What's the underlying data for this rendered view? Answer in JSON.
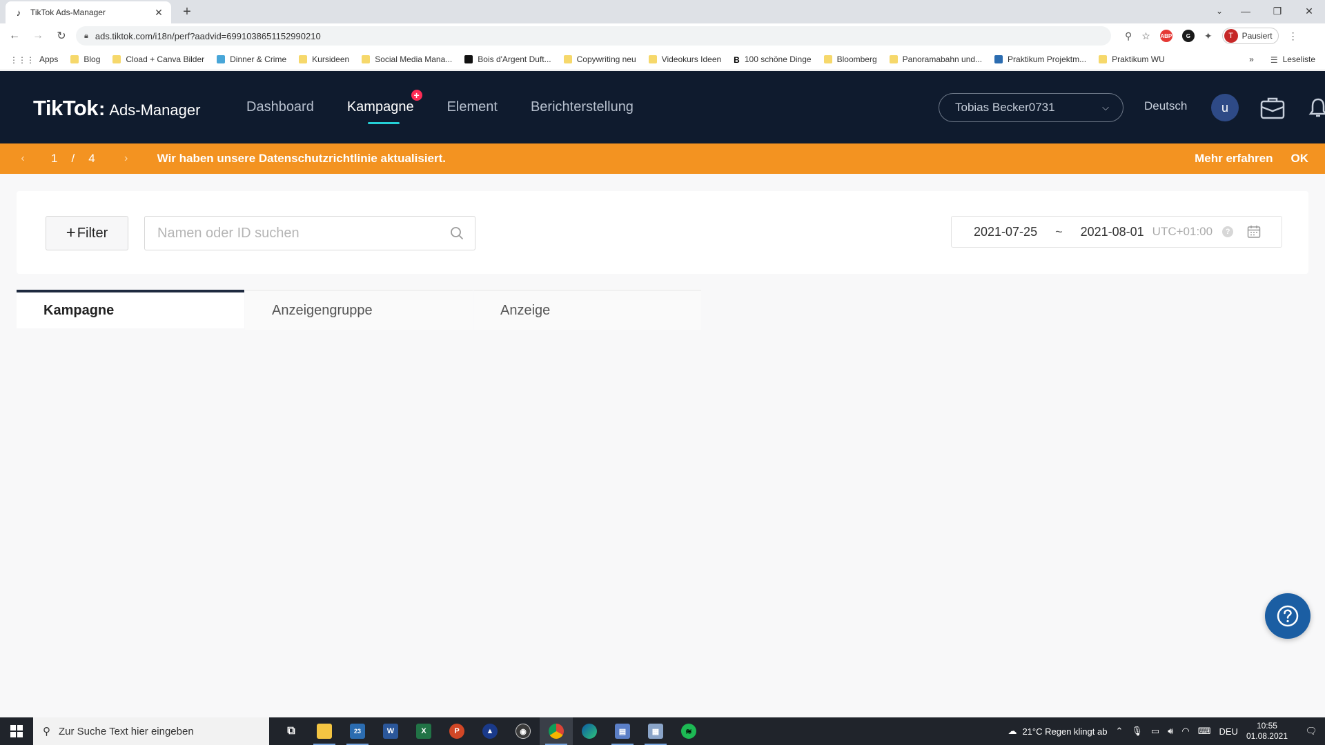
{
  "browser": {
    "tab_title": "TikTok Ads-Manager",
    "url": "ads.tiktok.com/i18n/perf?aadvid=6991038651152990210",
    "profile_status": "Pausiert",
    "profile_initial": "T",
    "bookmarks": [
      {
        "label": "Apps",
        "icon": "apps-grid-icon"
      },
      {
        "label": "Blog",
        "icon": "folder-icon"
      },
      {
        "label": "Cload + Canva Bilder",
        "icon": "folder-icon"
      },
      {
        "label": "Dinner & Crime",
        "icon": "site-icon"
      },
      {
        "label": "Kursideen",
        "icon": "folder-icon"
      },
      {
        "label": "Social Media Mana...",
        "icon": "folder-icon"
      },
      {
        "label": "Bois d'Argent Duft...",
        "icon": "site-icon"
      },
      {
        "label": "Copywriting neu",
        "icon": "folder-icon"
      },
      {
        "label": "Videokurs Ideen",
        "icon": "folder-icon"
      },
      {
        "label": "100 schöne Dinge",
        "icon": "site-icon"
      },
      {
        "label": "Bloomberg",
        "icon": "folder-icon"
      },
      {
        "label": "Panoramabahn und...",
        "icon": "folder-icon"
      },
      {
        "label": "Praktikum Projektm...",
        "icon": "site-icon"
      },
      {
        "label": "Praktikum WU",
        "icon": "folder-icon"
      }
    ],
    "reading_list": "Leseliste",
    "overflow": "»"
  },
  "app": {
    "brand": "TikTok",
    "product": "Ads-Manager",
    "nav": [
      {
        "label": "Dashboard",
        "active": false
      },
      {
        "label": "Kampagne",
        "active": true
      },
      {
        "label": "Element",
        "active": false
      },
      {
        "label": "Berichterstellung",
        "active": false
      }
    ],
    "nav_badge": "+",
    "account": "Tobias Becker0731",
    "language": "Deutsch",
    "user_initial": "u"
  },
  "notice": {
    "current": "1",
    "separator": "/",
    "total": "4",
    "message": "Wir haben unsere Datenschutzrichtlinie aktualisiert.",
    "learn_more": "Mehr erfahren",
    "ok": "OK"
  },
  "filters": {
    "filter_label": "Filter",
    "search_placeholder": "Namen oder ID suchen",
    "date_start": "2021-07-25",
    "date_sep": "~",
    "date_end": "2021-08-01",
    "timezone": "UTC+01:00"
  },
  "tabs": [
    {
      "label": "Kampagne",
      "active": true
    },
    {
      "label": "Anzeigengruppe",
      "active": false
    },
    {
      "label": "Anzeige",
      "active": false
    }
  ],
  "taskbar": {
    "search_placeholder": "Zur Suche Text hier eingeben",
    "weather": "21°C  Regen klingt ab",
    "language": "DEU",
    "time": "10:55",
    "date": "01.08.2021",
    "mail_count": "23"
  },
  "colors": {
    "header_bg": "#0f1b2e",
    "notice_bg": "#f39321",
    "accent_teal": "#25d0d6",
    "badge_red": "#fe2c55",
    "help_fab": "#1b5ea3"
  }
}
